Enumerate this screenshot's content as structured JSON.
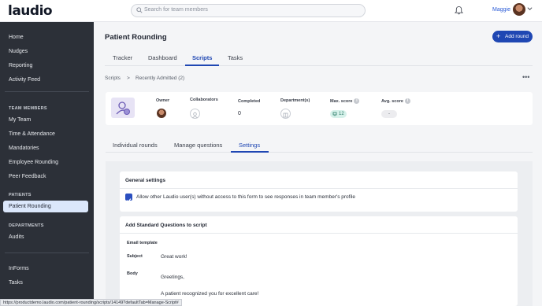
{
  "app": {
    "logo": "laudio"
  },
  "search": {
    "placeholder": "Search for team members"
  },
  "user": {
    "name": "Maggie"
  },
  "sidebar": {
    "items_top": [
      "Home",
      "Nudges",
      "Reporting",
      "Activity Feed"
    ],
    "section_team": "TEAM MEMBERS",
    "items_team": [
      "My Team",
      "Time & Attendance",
      "Mandatories",
      "Employee Rounding",
      "Peer Feedback"
    ],
    "section_patients": "PATIENTS",
    "item_patients_active": "Patient Rounding",
    "section_departments": "DEPARTMENTS",
    "items_departments": [
      "Audits"
    ],
    "items_bottom": [
      "InForms",
      "Tasks"
    ]
  },
  "page": {
    "title": "Patient Rounding",
    "add_button": "Add round",
    "tabs": [
      "Tracker",
      "Dashboard",
      "Scripts",
      "Tasks"
    ],
    "active_tab": "Scripts"
  },
  "breadcrumb": {
    "root": "Scripts",
    "separator": ">",
    "current": "Recently Admitted (2)"
  },
  "script_info": {
    "owner_label": "Owner",
    "collaborators_label": "Collaborators",
    "completed_label": "Completed",
    "completed_value": "0",
    "departments_label": "Department(s)",
    "max_score_label": "Max. score",
    "max_score_value": "12",
    "avg_score_label": "Avg. score",
    "avg_score_value": "-"
  },
  "sub_tabs": [
    "Individual rounds",
    "Manage questions",
    "Settings"
  ],
  "active_sub_tab": "Settings",
  "general_settings": {
    "title": "General settings",
    "checkbox_label": "Allow other Laudio user(s) without access to this form to see responses in team member's profile",
    "checked": true
  },
  "standard_questions": {
    "title": "Add Standard Questions to script",
    "email_template_label": "Email template",
    "subject_label": "Subject",
    "subject_value": "Great work!",
    "body_label": "Body",
    "body_line1": "Greetings,",
    "body_line2": "A patient recognized you for excellent care!"
  },
  "status_url": "https://productdemo.laudio.com/patient-rounding/scripts/14149?defaultTab=Manage-Script#",
  "colors": {
    "primary": "#1f47b3",
    "sidebar": "#2c3038",
    "active_nav": "#dbe7fb"
  }
}
